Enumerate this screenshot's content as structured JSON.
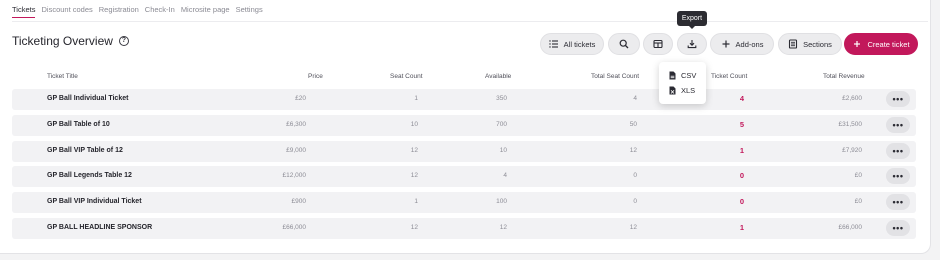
{
  "tabs": [
    {
      "label": "Tickets",
      "active": true
    },
    {
      "label": "Discount codes"
    },
    {
      "label": "Registration"
    },
    {
      "label": "Check-In"
    },
    {
      "label": "Microsite page"
    },
    {
      "label": "Settings"
    }
  ],
  "page_title": "Ticketing Overview",
  "toolbar": {
    "all_tickets": "All tickets",
    "addons": "Add-ons",
    "sections": "Sections",
    "create_ticket": "Create ticket",
    "export_tooltip": "Export"
  },
  "export_menu": [
    {
      "label": "CSV",
      "icon": "file-csv-icon"
    },
    {
      "label": "XLS",
      "icon": "file-xls-icon"
    }
  ],
  "table": {
    "columns": [
      "Ticket Title",
      "Price",
      "Seat Count",
      "Available",
      "Total Seat Count",
      "Ticket Count",
      "Total Revenue"
    ],
    "rows": [
      {
        "title": "GP Ball Individual Ticket",
        "price": "£20",
        "seat_count": "1",
        "available": "350",
        "total_seat_count": "4",
        "ticket_count": "4",
        "total_revenue": "£2,600"
      },
      {
        "title": "GP Ball Table of 10",
        "price": "£6,300",
        "seat_count": "10",
        "available": "700",
        "total_seat_count": "50",
        "ticket_count": "5",
        "total_revenue": "£31,500"
      },
      {
        "title": "GP Ball VIP Table of 12",
        "price": "£9,000",
        "seat_count": "12",
        "available": "10",
        "total_seat_count": "12",
        "ticket_count": "1",
        "total_revenue": "£7,920"
      },
      {
        "title": "GP Ball Legends Table 12",
        "price": "£12,000",
        "seat_count": "12",
        "available": "4",
        "total_seat_count": "0",
        "ticket_count": "0",
        "total_revenue": "£0"
      },
      {
        "title": "GP Ball VIP Individual Ticket",
        "price": "£900",
        "seat_count": "1",
        "available": "100",
        "total_seat_count": "0",
        "ticket_count": "0",
        "total_revenue": "£0"
      },
      {
        "title": "GP BALL HEADLINE SPONSOR",
        "price": "£66,000",
        "seat_count": "12",
        "available": "12",
        "total_seat_count": "12",
        "ticket_count": "1",
        "total_revenue": "£66,000"
      }
    ],
    "more_label": "•••"
  },
  "colors": {
    "accent": "#c2185b",
    "row_bg": "#f2f2f4",
    "button_bg": "#ececee"
  }
}
